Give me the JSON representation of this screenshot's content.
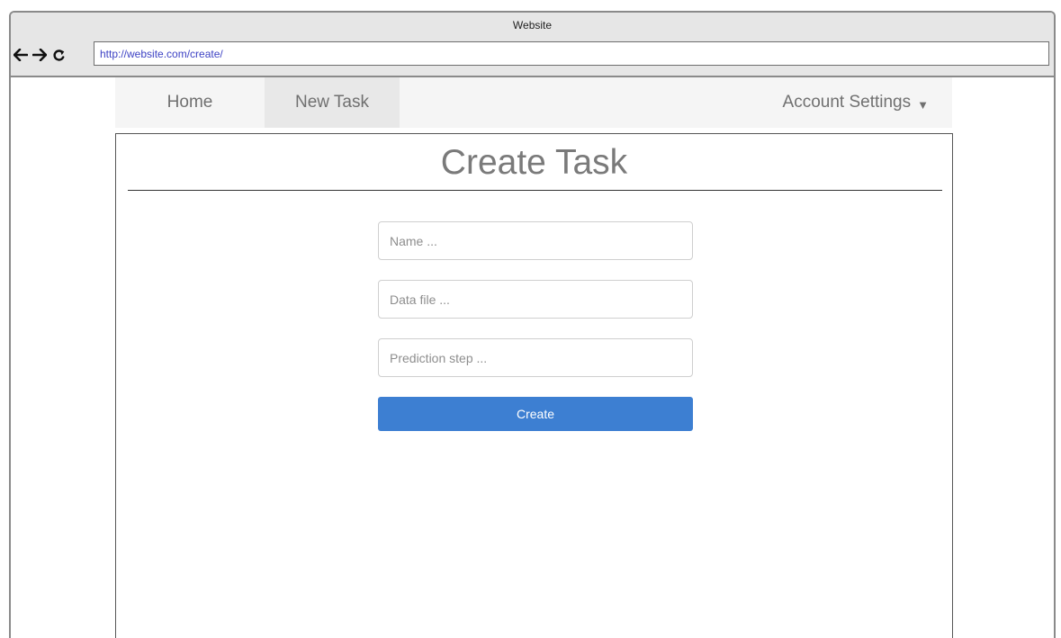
{
  "window": {
    "title": "Website",
    "url": "http://website.com/create/"
  },
  "nav_buttons": {
    "back_icon": "arrow-left-icon",
    "forward_icon": "arrow-right-icon",
    "reload_icon": "reload-icon"
  },
  "navbar": {
    "items": [
      {
        "label": "Home"
      },
      {
        "label": "New Task",
        "active": true
      },
      {
        "label": "Account Settings",
        "icon": "caret-down-icon"
      }
    ]
  },
  "form": {
    "title": "Create Task",
    "fields": [
      {
        "placeholder": "Name ...",
        "value": ""
      },
      {
        "placeholder": "Data file ...",
        "value": ""
      },
      {
        "placeholder": "Prediction step ...",
        "value": ""
      }
    ],
    "submit_label": "Create"
  },
  "colors": {
    "primary_button": "#3d7fd2",
    "url_text": "#3d42c4",
    "active_nav_background": "#e8e8e8"
  }
}
